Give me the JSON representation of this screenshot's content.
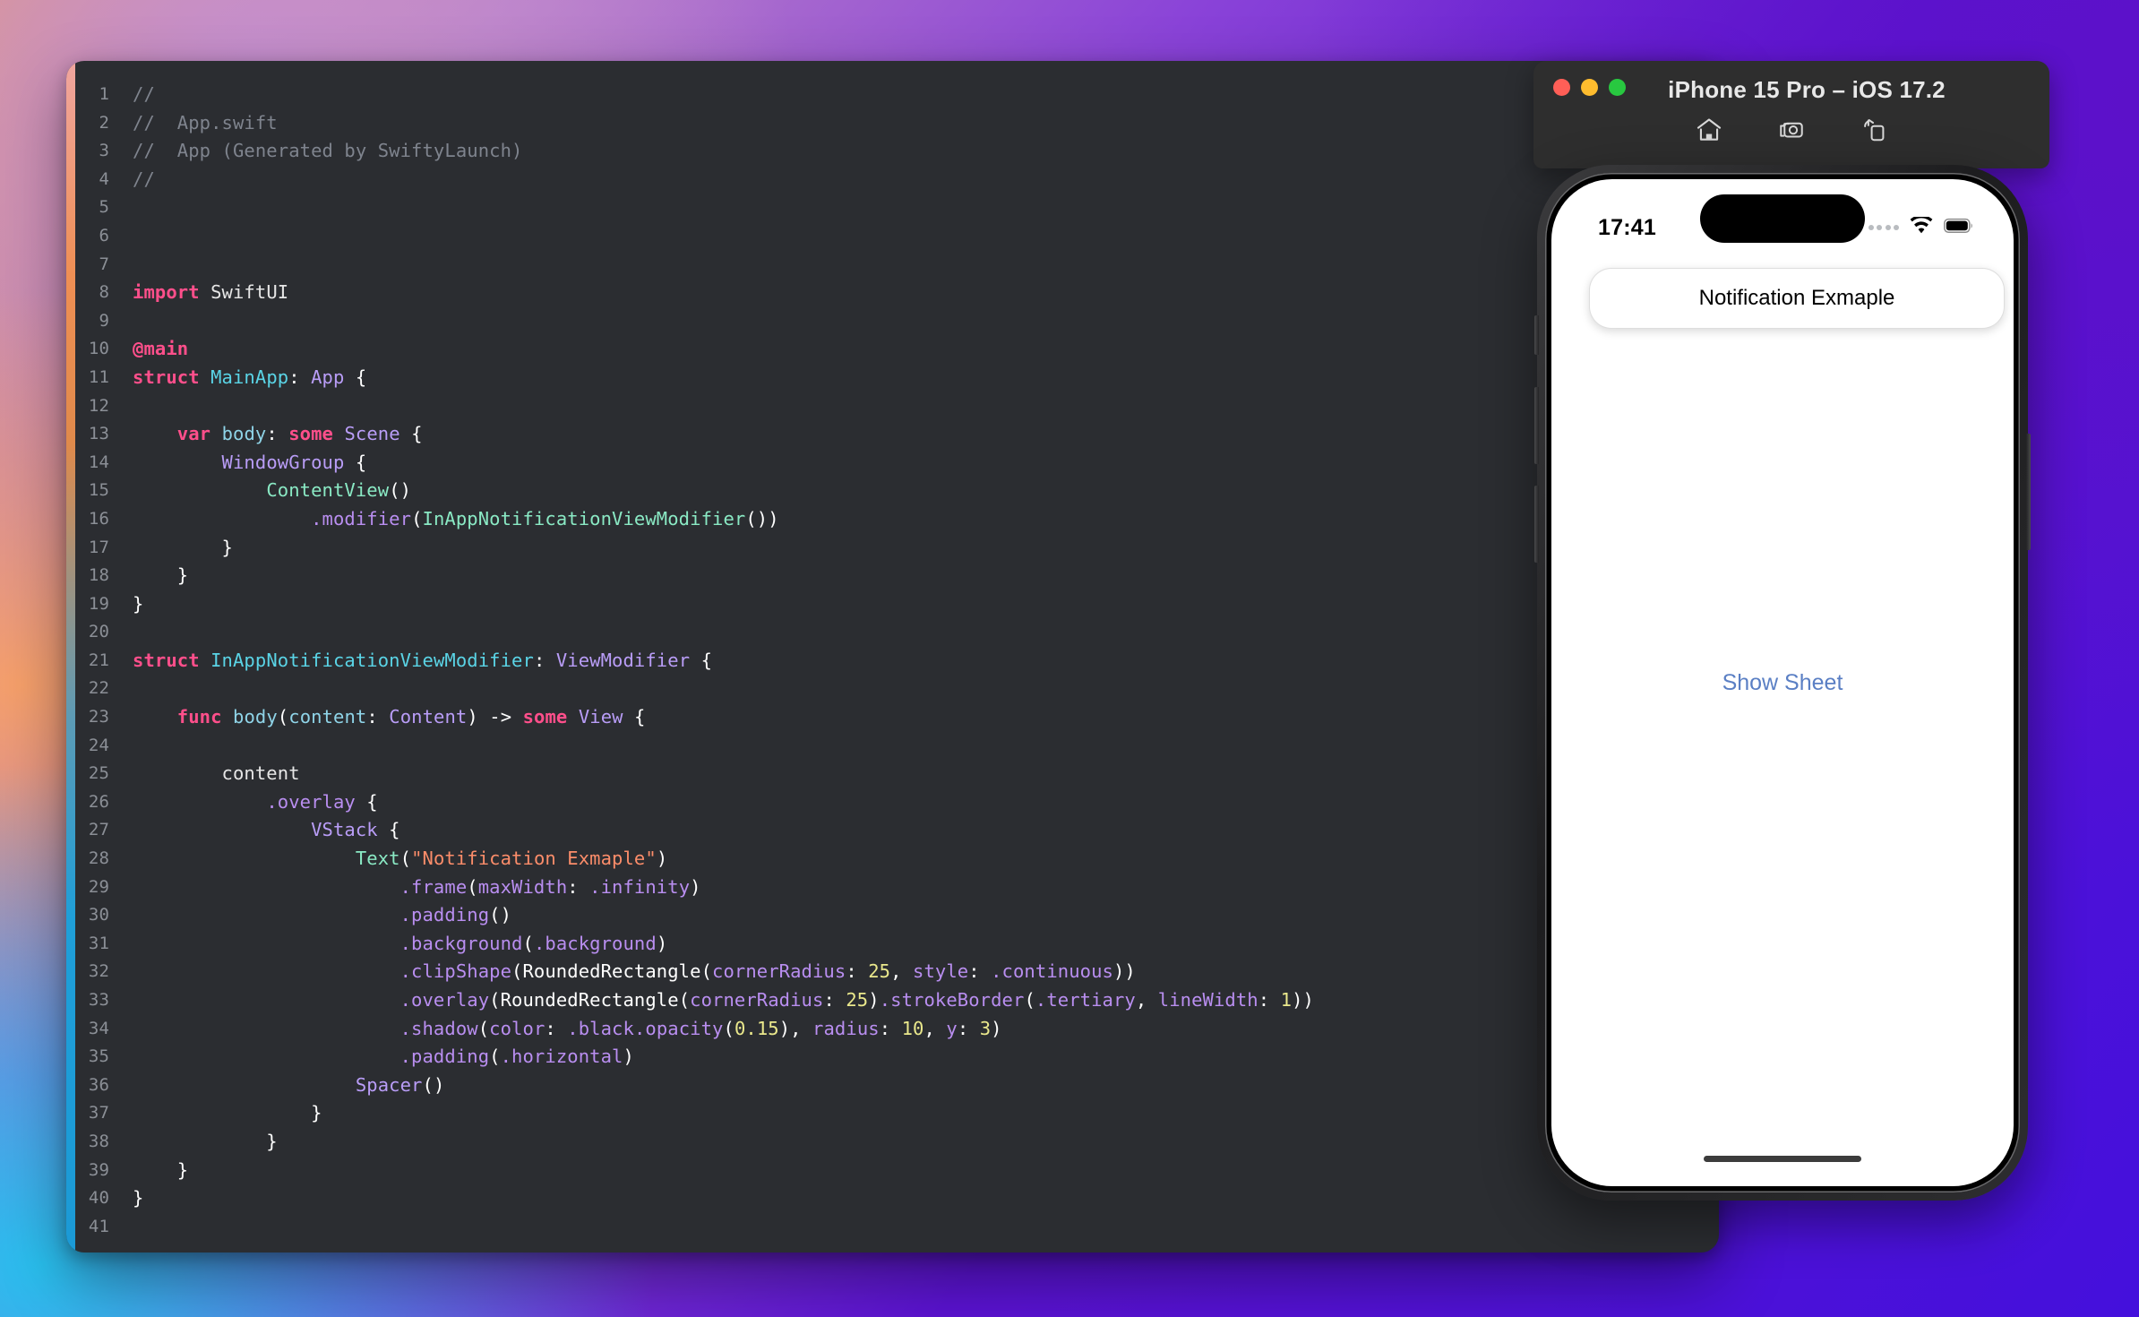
{
  "editor": {
    "name": "code-editor",
    "accent_colors": [
      "#f0a6a0",
      "#ef8f54",
      "#5d9bb5",
      "#1f9fd8"
    ],
    "background": "#2b2d31",
    "lines": [
      {
        "n": "1",
        "tokens": [
          {
            "t": "//",
            "c": "cmt"
          }
        ]
      },
      {
        "n": "2",
        "tokens": [
          {
            "t": "//  App.swift",
            "c": "cmt"
          }
        ]
      },
      {
        "n": "3",
        "tokens": [
          {
            "t": "//  App (Generated by SwiftyLaunch)",
            "c": "cmt"
          }
        ]
      },
      {
        "n": "4",
        "tokens": [
          {
            "t": "//",
            "c": "cmt"
          }
        ]
      },
      {
        "n": "5",
        "tokens": []
      },
      {
        "n": "6",
        "tokens": []
      },
      {
        "n": "7",
        "tokens": []
      },
      {
        "n": "8",
        "tokens": [
          {
            "t": "import",
            "c": "kw"
          },
          {
            "t": " ",
            "c": "plain"
          },
          {
            "t": "SwiftUI",
            "c": "plain"
          }
        ]
      },
      {
        "n": "9",
        "tokens": []
      },
      {
        "n": "10",
        "tokens": [
          {
            "t": "@main",
            "c": "kw"
          }
        ]
      },
      {
        "n": "11",
        "tokens": [
          {
            "t": "struct",
            "c": "kw"
          },
          {
            "t": " ",
            "c": "plain"
          },
          {
            "t": "MainApp",
            "c": "typec"
          },
          {
            "t": ": ",
            "c": "punct"
          },
          {
            "t": "App",
            "c": "type"
          },
          {
            "t": " {",
            "c": "punct"
          }
        ]
      },
      {
        "n": "12",
        "tokens": []
      },
      {
        "n": "13",
        "tokens": [
          {
            "t": "    ",
            "c": "plain"
          },
          {
            "t": "var",
            "c": "kw"
          },
          {
            "t": " ",
            "c": "plain"
          },
          {
            "t": "body",
            "c": "prop"
          },
          {
            "t": ": ",
            "c": "punct"
          },
          {
            "t": "some",
            "c": "kw"
          },
          {
            "t": " ",
            "c": "plain"
          },
          {
            "t": "Scene",
            "c": "type"
          },
          {
            "t": " {",
            "c": "punct"
          }
        ]
      },
      {
        "n": "14",
        "tokens": [
          {
            "t": "        ",
            "c": "plain"
          },
          {
            "t": "WindowGroup",
            "c": "type"
          },
          {
            "t": " {",
            "c": "punct"
          }
        ]
      },
      {
        "n": "15",
        "tokens": [
          {
            "t": "            ",
            "c": "plain"
          },
          {
            "t": "ContentView",
            "c": "fn"
          },
          {
            "t": "()",
            "c": "punct"
          }
        ]
      },
      {
        "n": "16",
        "tokens": [
          {
            "t": "                ",
            "c": "plain"
          },
          {
            "t": ".modifier",
            "c": "mod"
          },
          {
            "t": "(",
            "c": "punct"
          },
          {
            "t": "InAppNotificationViewModifier",
            "c": "fn"
          },
          {
            "t": "())",
            "c": "punct"
          }
        ]
      },
      {
        "n": "17",
        "tokens": [
          {
            "t": "        }",
            "c": "punct"
          }
        ]
      },
      {
        "n": "18",
        "tokens": [
          {
            "t": "    }",
            "c": "punct"
          }
        ]
      },
      {
        "n": "19",
        "tokens": [
          {
            "t": "}",
            "c": "punct"
          }
        ]
      },
      {
        "n": "20",
        "tokens": []
      },
      {
        "n": "21",
        "tokens": [
          {
            "t": "struct",
            "c": "kw"
          },
          {
            "t": " ",
            "c": "plain"
          },
          {
            "t": "InAppNotificationViewModifier",
            "c": "typec"
          },
          {
            "t": ": ",
            "c": "punct"
          },
          {
            "t": "ViewModifier",
            "c": "type"
          },
          {
            "t": " {",
            "c": "punct"
          }
        ]
      },
      {
        "n": "22",
        "tokens": []
      },
      {
        "n": "23",
        "tokens": [
          {
            "t": "    ",
            "c": "plain"
          },
          {
            "t": "func",
            "c": "kw"
          },
          {
            "t": " ",
            "c": "plain"
          },
          {
            "t": "body",
            "c": "prop"
          },
          {
            "t": "(",
            "c": "punct"
          },
          {
            "t": "content",
            "c": "prop"
          },
          {
            "t": ": ",
            "c": "punct"
          },
          {
            "t": "Content",
            "c": "type"
          },
          {
            "t": ") ",
            "c": "punct"
          },
          {
            "t": "->",
            "c": "punct"
          },
          {
            "t": " ",
            "c": "plain"
          },
          {
            "t": "some",
            "c": "kw"
          },
          {
            "t": " ",
            "c": "plain"
          },
          {
            "t": "View",
            "c": "type"
          },
          {
            "t": " {",
            "c": "punct"
          }
        ]
      },
      {
        "n": "24",
        "tokens": []
      },
      {
        "n": "25",
        "tokens": [
          {
            "t": "        content",
            "c": "plain"
          }
        ]
      },
      {
        "n": "26",
        "tokens": [
          {
            "t": "            ",
            "c": "plain"
          },
          {
            "t": ".overlay",
            "c": "mod"
          },
          {
            "t": " {",
            "c": "punct"
          }
        ]
      },
      {
        "n": "27",
        "tokens": [
          {
            "t": "                ",
            "c": "plain"
          },
          {
            "t": "VStack",
            "c": "type"
          },
          {
            "t": " {",
            "c": "punct"
          }
        ]
      },
      {
        "n": "28",
        "tokens": [
          {
            "t": "                    ",
            "c": "plain"
          },
          {
            "t": "Text",
            "c": "fn"
          },
          {
            "t": "(",
            "c": "punct"
          },
          {
            "t": "\"Notification Exmaple\"",
            "c": "str"
          },
          {
            "t": ")",
            "c": "punct"
          }
        ]
      },
      {
        "n": "29",
        "tokens": [
          {
            "t": "                        ",
            "c": "plain"
          },
          {
            "t": ".frame",
            "c": "mod"
          },
          {
            "t": "(",
            "c": "punct"
          },
          {
            "t": "maxWidth",
            "c": "mod"
          },
          {
            "t": ": ",
            "c": "punct"
          },
          {
            "t": ".infinity",
            "c": "mod"
          },
          {
            "t": ")",
            "c": "punct"
          }
        ]
      },
      {
        "n": "30",
        "tokens": [
          {
            "t": "                        ",
            "c": "plain"
          },
          {
            "t": ".padding",
            "c": "mod"
          },
          {
            "t": "()",
            "c": "punct"
          }
        ]
      },
      {
        "n": "31",
        "tokens": [
          {
            "t": "                        ",
            "c": "plain"
          },
          {
            "t": ".background",
            "c": "mod"
          },
          {
            "t": "(",
            "c": "punct"
          },
          {
            "t": ".background",
            "c": "mod"
          },
          {
            "t": ")",
            "c": "punct"
          }
        ]
      },
      {
        "n": "32",
        "tokens": [
          {
            "t": "                        ",
            "c": "plain"
          },
          {
            "t": ".clipShape",
            "c": "mod"
          },
          {
            "t": "(",
            "c": "punct"
          },
          {
            "t": "RoundedRectangle",
            "c": "punct"
          },
          {
            "t": "(",
            "c": "punct"
          },
          {
            "t": "cornerRadius",
            "c": "mod"
          },
          {
            "t": ": ",
            "c": "punct"
          },
          {
            "t": "25",
            "c": "num"
          },
          {
            "t": ", ",
            "c": "punct"
          },
          {
            "t": "style",
            "c": "mod"
          },
          {
            "t": ": ",
            "c": "punct"
          },
          {
            "t": ".continuous",
            "c": "mod"
          },
          {
            "t": "))",
            "c": "punct"
          }
        ]
      },
      {
        "n": "33",
        "tokens": [
          {
            "t": "                        ",
            "c": "plain"
          },
          {
            "t": ".overlay",
            "c": "mod"
          },
          {
            "t": "(",
            "c": "punct"
          },
          {
            "t": "RoundedRectangle",
            "c": "punct"
          },
          {
            "t": "(",
            "c": "punct"
          },
          {
            "t": "cornerRadius",
            "c": "mod"
          },
          {
            "t": ": ",
            "c": "punct"
          },
          {
            "t": "25",
            "c": "num"
          },
          {
            "t": ")",
            "c": "punct"
          },
          {
            "t": ".strokeBorder",
            "c": "mod"
          },
          {
            "t": "(",
            "c": "punct"
          },
          {
            "t": ".tertiary",
            "c": "mod"
          },
          {
            "t": ", ",
            "c": "punct"
          },
          {
            "t": "lineWidth",
            "c": "mod"
          },
          {
            "t": ": ",
            "c": "punct"
          },
          {
            "t": "1",
            "c": "num"
          },
          {
            "t": "))",
            "c": "punct"
          }
        ]
      },
      {
        "n": "34",
        "tokens": [
          {
            "t": "                        ",
            "c": "plain"
          },
          {
            "t": ".shadow",
            "c": "mod"
          },
          {
            "t": "(",
            "c": "punct"
          },
          {
            "t": "color",
            "c": "mod"
          },
          {
            "t": ": ",
            "c": "punct"
          },
          {
            "t": ".black",
            "c": "mod"
          },
          {
            "t": ".opacity",
            "c": "mod"
          },
          {
            "t": "(",
            "c": "punct"
          },
          {
            "t": "0.15",
            "c": "num"
          },
          {
            "t": "), ",
            "c": "punct"
          },
          {
            "t": "radius",
            "c": "mod"
          },
          {
            "t": ": ",
            "c": "punct"
          },
          {
            "t": "10",
            "c": "num"
          },
          {
            "t": ", ",
            "c": "punct"
          },
          {
            "t": "y",
            "c": "mod"
          },
          {
            "t": ": ",
            "c": "punct"
          },
          {
            "t": "3",
            "c": "num"
          },
          {
            "t": ")",
            "c": "punct"
          }
        ]
      },
      {
        "n": "35",
        "tokens": [
          {
            "t": "                        ",
            "c": "plain"
          },
          {
            "t": ".padding",
            "c": "mod"
          },
          {
            "t": "(",
            "c": "punct"
          },
          {
            "t": ".horizontal",
            "c": "mod"
          },
          {
            "t": ")",
            "c": "punct"
          }
        ]
      },
      {
        "n": "36",
        "tokens": [
          {
            "t": "                    ",
            "c": "plain"
          },
          {
            "t": "Spacer",
            "c": "type"
          },
          {
            "t": "()",
            "c": "punct"
          }
        ]
      },
      {
        "n": "37",
        "tokens": [
          {
            "t": "                }",
            "c": "punct"
          }
        ]
      },
      {
        "n": "38",
        "tokens": [
          {
            "t": "            }",
            "c": "punct"
          }
        ]
      },
      {
        "n": "39",
        "tokens": [
          {
            "t": "    }",
            "c": "punct"
          }
        ]
      },
      {
        "n": "40",
        "tokens": [
          {
            "t": "}",
            "c": "punct"
          }
        ]
      },
      {
        "n": "41",
        "tokens": []
      }
    ]
  },
  "simulator": {
    "title": "iPhone 15 Pro – iOS 17.2",
    "traffic_lights": [
      {
        "name": "close",
        "color": "#ff5f57"
      },
      {
        "name": "minimize",
        "color": "#febc2e"
      },
      {
        "name": "zoom",
        "color": "#28c840"
      }
    ],
    "toolbar_icons": [
      "home-icon",
      "screenshot-icon",
      "rotate-icon"
    ],
    "status_bar": {
      "time": "17:41",
      "icons": [
        "cellular-dots-icon",
        "wifi-icon",
        "battery-icon"
      ]
    },
    "notification_banner": {
      "text": "Notification Exmaple"
    },
    "content": {
      "show_sheet_label": "Show Sheet",
      "link_color": "#5a7fc4"
    }
  }
}
